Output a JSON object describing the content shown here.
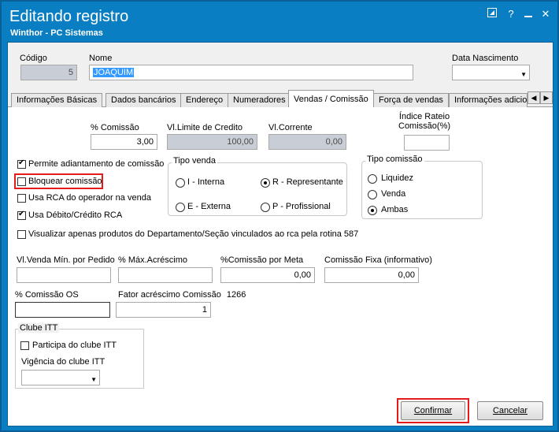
{
  "window": {
    "title": "Editando registro",
    "subtitle": "Winthor - PC Sistemas"
  },
  "header": {
    "codigo_label": "Código",
    "codigo_value": "5",
    "nome_label": "Nome",
    "nome_value": "JOAQUIM",
    "nascimento_label": "Data Nascimento",
    "nascimento_value": ""
  },
  "tabs": [
    {
      "label": "Informações Básicas"
    },
    {
      "label": "Dados bancários"
    },
    {
      "label": "Endereço"
    },
    {
      "label": "Numeradores"
    },
    {
      "label": "Vendas  / Comissão",
      "active": true
    },
    {
      "label": "Força de vendas"
    },
    {
      "label": "Informações adicio"
    }
  ],
  "vendas": {
    "comissao_label": "% Comissão",
    "comissao_value": "3,00",
    "limite_label": "Vl.Limite de Credito",
    "limite_value": "100,00",
    "corrente_label": "Vl.Corrente",
    "corrente_value": "0,00",
    "indice_label_1": "Índice Rateio",
    "indice_label_2": "Comissão(%)",
    "indice_value": ""
  },
  "checks": {
    "permite": {
      "label": "Permite adiantamento de comissão",
      "checked": true
    },
    "bloquear": {
      "label": "Bloquear comissão",
      "checked": false
    },
    "usa_rca": {
      "label": "Usa RCA do operador na venda",
      "checked": false
    },
    "usa_debito": {
      "label": "Usa Débito/Crédito RCA",
      "checked": true
    },
    "visualizar": {
      "label": "Visualizar apenas produtos do Departamento/Seção vinculados ao rca pela rotina 587",
      "checked": false
    }
  },
  "tipo_venda": {
    "title": "Tipo venda",
    "options": [
      {
        "label": "I - Interna",
        "selected": false
      },
      {
        "label": "R - Representante",
        "selected": true
      },
      {
        "label": "E - Externa",
        "selected": false
      },
      {
        "label": "P - Profissional",
        "selected": false
      }
    ]
  },
  "tipo_comissao": {
    "title": "Tipo comissão",
    "options": [
      {
        "label": "Liquidez",
        "selected": false
      },
      {
        "label": "Venda",
        "selected": false
      },
      {
        "label": "Ambas",
        "selected": true
      }
    ]
  },
  "lower": {
    "vl_venda_label": "Vl.Venda Mín. por Pedido",
    "vl_venda_value": "",
    "max_acrescimo_label": "% Máx.Acréscimo",
    "max_acrescimo_value": "",
    "comissao_meta_label": "%Comissão por Meta",
    "comissao_meta_value": "0,00",
    "comissao_fixa_label": "Comissão Fixa (informativo)",
    "comissao_fixa_value": "0,00",
    "comissao_os_label": "% Comissão OS",
    "comissao_os_value": "",
    "fator_label": "Fator acréscimo Comissão",
    "fator_code": "1266",
    "fator_value": "1"
  },
  "clube": {
    "title": "Clube ITT",
    "participa_label": "Participa do clube ITT",
    "vigencia_label": "Vigência do clube ITT",
    "vigencia_value": ""
  },
  "buttons": {
    "confirmar": "Confirmar",
    "cancelar": "Cancelar"
  },
  "colors": {
    "title_bar": "#0a7ec2",
    "highlight": "#e51b1b",
    "selection": "#3399ff"
  }
}
